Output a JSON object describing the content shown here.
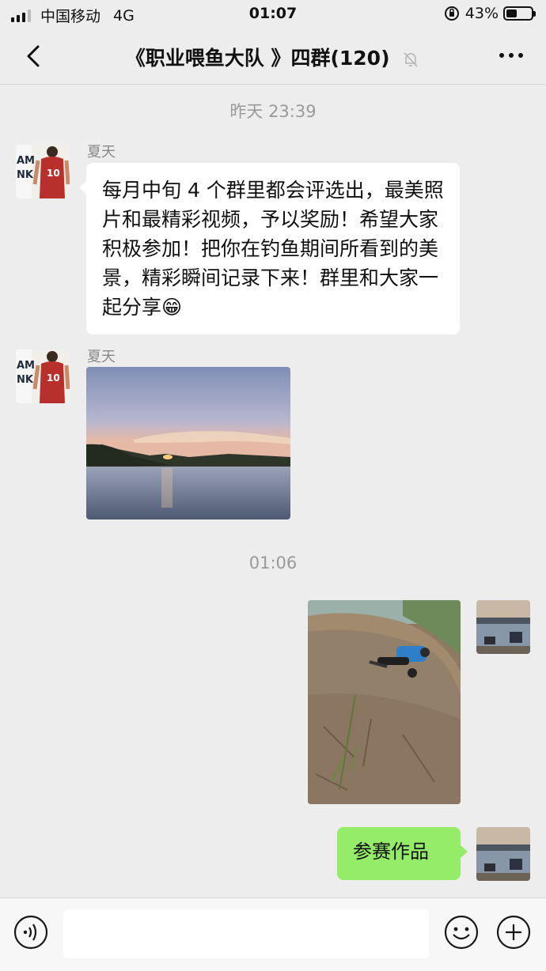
{
  "status_bar": {
    "carrier": "中国移动",
    "network": "4G",
    "time": "01:07",
    "battery_text": "43%",
    "battery_level": 0.43
  },
  "header": {
    "title": "《职业喂鱼大队 》四群(120)",
    "icons": {
      "back": "chevron-left",
      "mute": "bell-off",
      "more": "ellipsis"
    }
  },
  "chat": {
    "timestamp_1": "昨天 23:39",
    "msg1": {
      "sender": "夏天",
      "text": "每月中旬 4 个群里都会评选出，最美照片和最精彩视频，予以奖励！希望大家积极参加！把你在钓鱼期间所看到的美景，精彩瞬间记录下来！群里和大家一起分享😁"
    },
    "msg2": {
      "sender": "夏天",
      "image": "sunset-lake-photo"
    },
    "timestamp_2": "01:06",
    "msg3": {
      "image": "dirt-slope-photo"
    },
    "msg4": {
      "text": "参赛作品"
    }
  },
  "input_bar": {
    "placeholder": "",
    "icons": {
      "voice": "voice",
      "emoji": "smiley",
      "more": "plus"
    }
  },
  "colors": {
    "background": "#ededed",
    "sent_bubble": "#95ec69",
    "received_bubble": "#ffffff"
  }
}
